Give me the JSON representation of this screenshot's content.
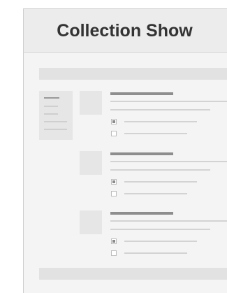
{
  "header": {
    "title": "Collection Show"
  },
  "sidebar": {
    "lines": [
      "dark",
      "light",
      "light",
      "light",
      "light"
    ]
  },
  "items": [
    {
      "options": [
        {
          "checked": true
        },
        {
          "checked": false
        }
      ]
    },
    {
      "options": [
        {
          "checked": true
        },
        {
          "checked": false
        }
      ]
    },
    {
      "options": [
        {
          "checked": true
        },
        {
          "checked": false
        }
      ]
    }
  ],
  "colors": {
    "page_bg": "#f4f4f4",
    "header_bg": "#ececec",
    "title": "#333333",
    "placeholder_dark": "#8e8e8e",
    "placeholder_light": "#d3d3d3"
  }
}
